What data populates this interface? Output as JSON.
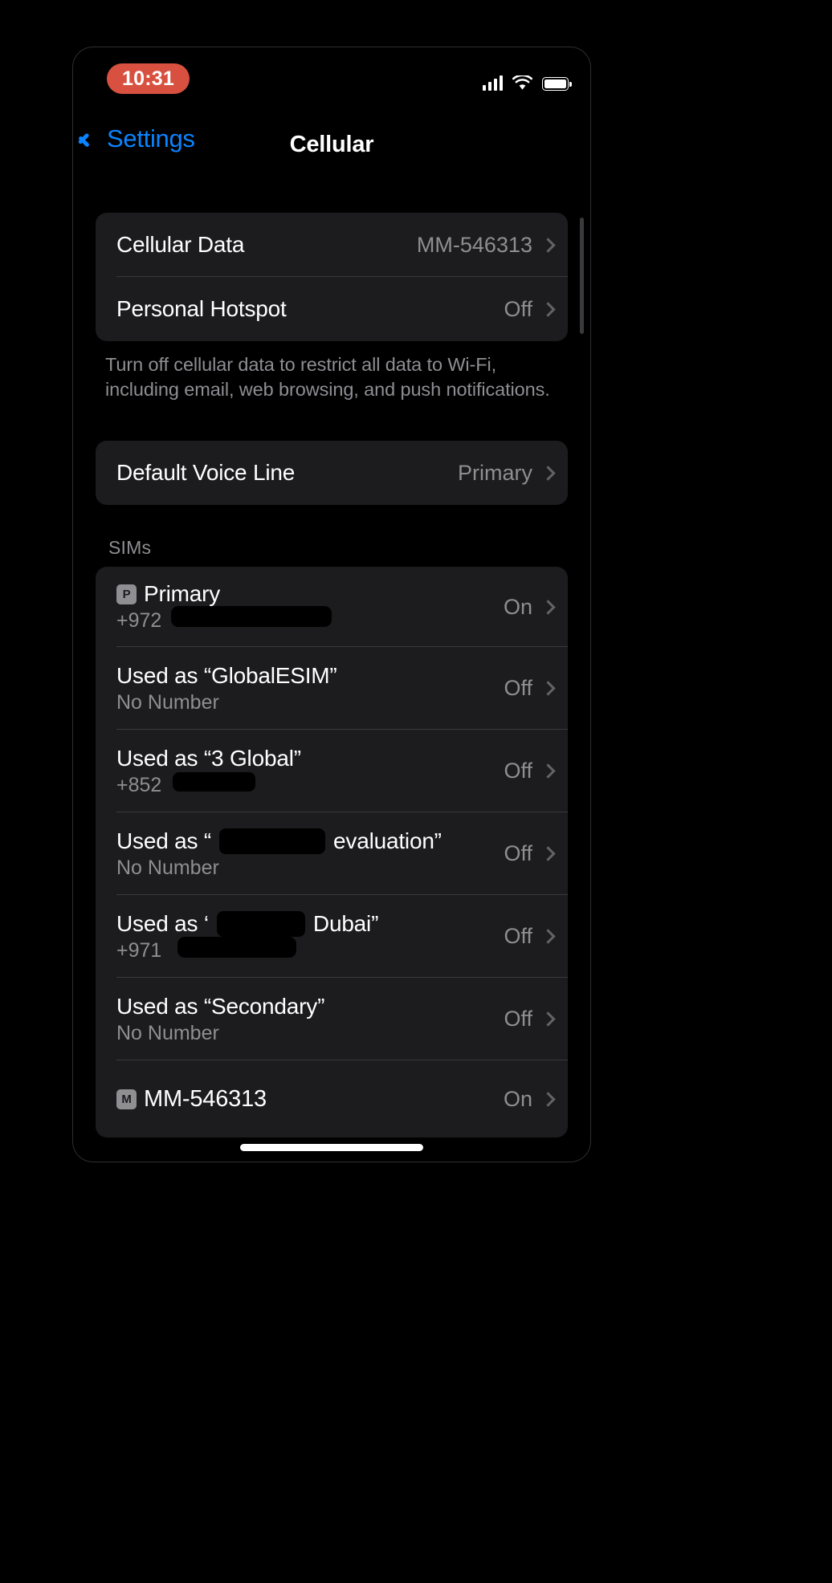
{
  "status_bar": {
    "time": "10:31",
    "time_pill_color": "#d8503f",
    "signal_icon": "cellular-signal-icon",
    "wifi_icon": "wifi-icon",
    "battery_icon": "battery-full-icon"
  },
  "nav": {
    "back_label": "Settings",
    "title": "Cellular",
    "accent_color": "#0a84ff"
  },
  "sections": {
    "data": {
      "rows": [
        {
          "title": "Cellular Data",
          "value": "MM-546313"
        },
        {
          "title": "Personal Hotspot",
          "value": "Off"
        }
      ],
      "footer": "Turn off cellular data to restrict all data to Wi-Fi, including email, web browsing, and push notifications."
    },
    "voice": {
      "rows": [
        {
          "title": "Default Voice Line",
          "value": "Primary"
        }
      ]
    },
    "sims": {
      "header": "SIMs",
      "rows": [
        {
          "badge": "P",
          "title": "Primary",
          "sub": "+972",
          "sub_redacted": true,
          "value": "On"
        },
        {
          "badge": "",
          "title": "Used as “GlobalESIM”",
          "sub": "No Number",
          "sub_redacted": false,
          "value": "Off"
        },
        {
          "badge": "",
          "title": "Used as “3 Global”",
          "sub": "+852",
          "sub_redacted": true,
          "value": "Off"
        },
        {
          "badge": "",
          "title_prefix": "Used as “",
          "title_redacted": true,
          "title_suffix": "evaluation”",
          "sub": "No Number",
          "sub_redacted": false,
          "value": "Off"
        },
        {
          "badge": "",
          "title_prefix": "Used as ‘",
          "title_redacted": true,
          "title_suffix": "Dubai”",
          "sub": "+971",
          "sub_redacted": true,
          "value": "Off"
        },
        {
          "badge": "",
          "title": "Used as “Secondary”",
          "sub": "No Number",
          "sub_redacted": false,
          "value": "Off"
        },
        {
          "badge": "M",
          "title": "MM-546313",
          "sub": "",
          "sub_redacted": false,
          "value": "On"
        }
      ]
    }
  }
}
